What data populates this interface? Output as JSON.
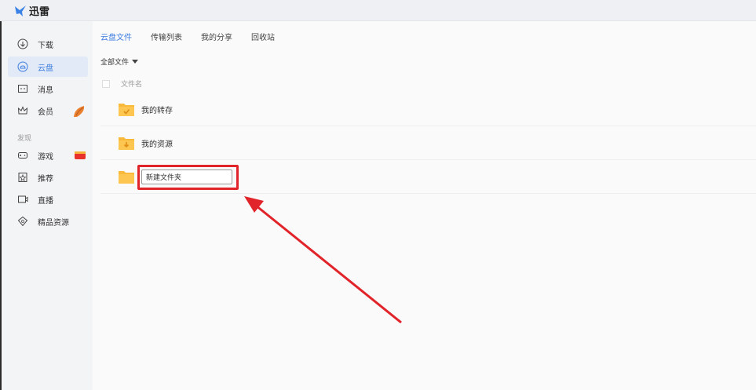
{
  "app": {
    "title": "迅雷"
  },
  "sidebar": {
    "items": [
      {
        "label": "下载"
      },
      {
        "label": "云盘"
      },
      {
        "label": "消息"
      },
      {
        "label": "会员"
      }
    ],
    "section_label": "发现",
    "discover": [
      {
        "label": "游戏"
      },
      {
        "label": "推荐"
      },
      {
        "label": "直播"
      },
      {
        "label": "精品资源"
      }
    ]
  },
  "tabs": [
    {
      "label": "云盘文件"
    },
    {
      "label": "传输列表"
    },
    {
      "label": "我的分享"
    },
    {
      "label": "回收站"
    }
  ],
  "filter": {
    "label": "全部文件"
  },
  "list": {
    "column_name": "文件名",
    "rows": [
      {
        "name": "我的转存"
      },
      {
        "name": "我的资源"
      }
    ],
    "new_folder_value": "新建文件夹"
  },
  "colors": {
    "accent": "#3d7de0",
    "folder": "#f9b93a",
    "highlight": "#e1242a"
  }
}
